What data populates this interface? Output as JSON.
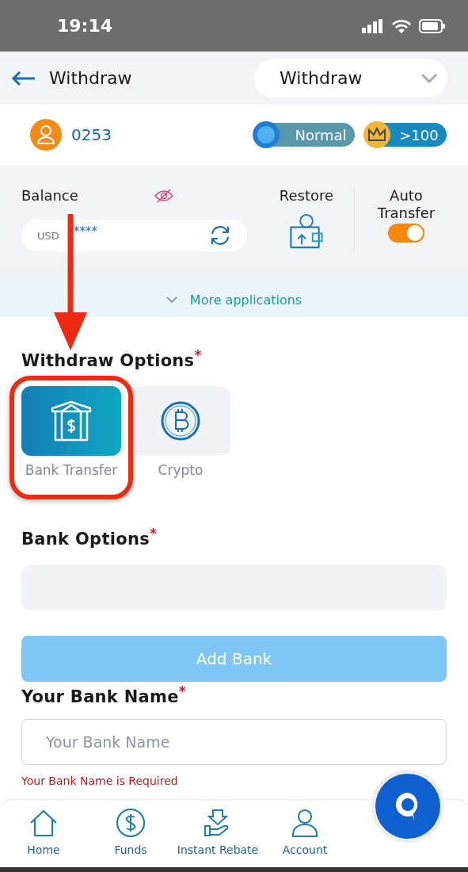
{
  "status_bar": {
    "time": "19:14"
  },
  "header": {
    "title": "Withdraw",
    "dropdown": "Withdraw"
  },
  "profile": {
    "account": "0253",
    "level_badge": "Normal",
    "vip_badge": ">100"
  },
  "balance": {
    "label": "Balance",
    "currency": "USD",
    "amount": "****",
    "restore": "Restore",
    "auto_transfer": {
      "label": "Auto Transfer",
      "on": true
    }
  },
  "more_applications": "More applications",
  "withdraw_options": {
    "title": "Withdraw Options",
    "required_mark": "*",
    "options": [
      {
        "label": "Bank Transfer",
        "kind": "bank",
        "selected": true
      },
      {
        "label": "Crypto",
        "kind": "crypto",
        "selected": false
      }
    ]
  },
  "bank_options": {
    "title": "Bank Options",
    "required_mark": "*",
    "add_button": "Add Bank"
  },
  "bank_name": {
    "title": "Your Bank Name",
    "required_mark": "*",
    "placeholder": "Your Bank Name",
    "error": "Your Bank Name is Required"
  },
  "nav": [
    {
      "label": "Home",
      "kind": "home"
    },
    {
      "label": "Funds",
      "kind": "funds"
    },
    {
      "label": "Instant Rebate",
      "kind": "rebate"
    },
    {
      "label": "Account",
      "kind": "account"
    }
  ]
}
